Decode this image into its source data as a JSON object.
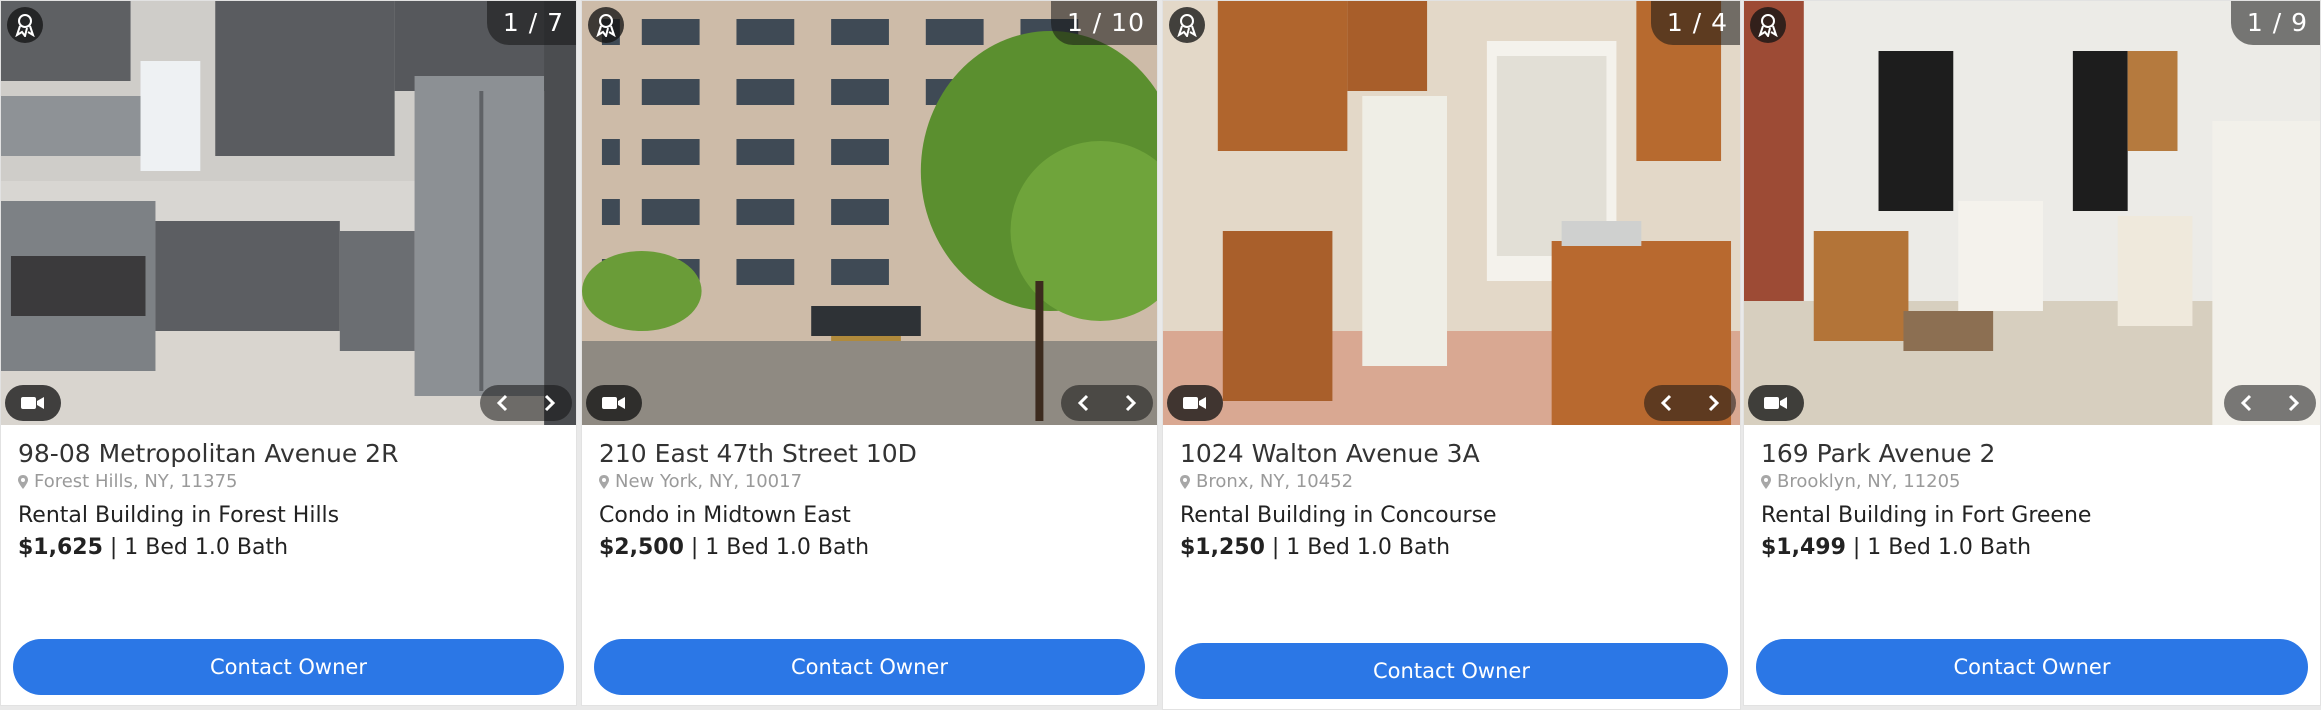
{
  "listings": [
    {
      "counter": "1 / 7",
      "title": "98-08 Metropolitan Avenue 2R",
      "location": "Forest Hills, NY, 11375",
      "type": "Rental Building in Forest Hills",
      "price": "$1,625",
      "details": "| 1 Bed 1.0 Bath",
      "cta": "Contact Owner"
    },
    {
      "counter": "1 / 10",
      "title": "210 East 47th Street 10D",
      "location": "New York, NY, 10017",
      "type": "Condo in Midtown East",
      "price": "$2,500",
      "details": "| 1 Bed 1.0 Bath",
      "cta": "Contact Owner"
    },
    {
      "counter": "1 / 4",
      "title": "1024 Walton Avenue 3A",
      "location": "Bronx, NY, 10452",
      "type": "Rental Building in Concourse",
      "price": "$1,250",
      "details": "| 1 Bed 1.0 Bath",
      "cta": "Contact Owner"
    },
    {
      "counter": "1 / 9",
      "title": "169 Park Avenue 2",
      "location": "Brooklyn, NY, 11205",
      "type": "Rental Building in Fort Greene",
      "price": "$1,499",
      "details": "| 1 Bed 1.0 Bath",
      "cta": "Contact Owner"
    }
  ],
  "icons": {
    "award": "award-ribbon-icon",
    "video": "video-camera-icon",
    "prev": "chevron-left-icon",
    "next": "chevron-right-icon",
    "location": "map-pin-icon"
  },
  "colors": {
    "cta": "#2b77e6",
    "overlay": "#141414"
  }
}
